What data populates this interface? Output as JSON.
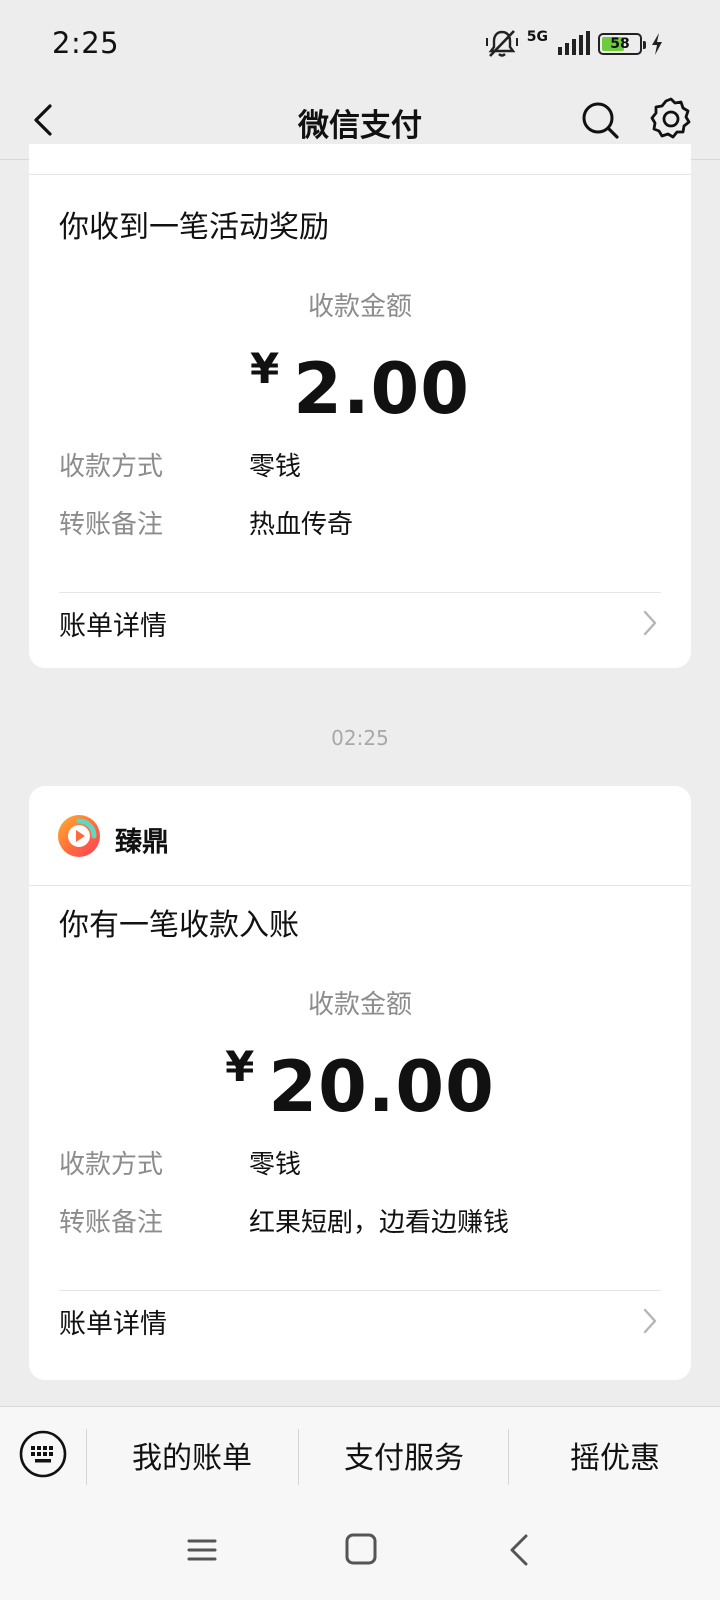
{
  "status_bar": {
    "time": "2:25",
    "network": "5G",
    "battery": "58"
  },
  "nav": {
    "title": "微信支付"
  },
  "cards": [
    {
      "title": "你收到一笔活动奖励",
      "amount_label": "收款金额",
      "currency": "¥",
      "amount": "2.00",
      "rows": [
        {
          "label": "收款方式",
          "value": "零钱"
        },
        {
          "label": "转账备注",
          "value": "热血传奇"
        }
      ],
      "detail_label": "账单详情"
    },
    {
      "brand": "臻鼎",
      "title": "你有一笔收款入账",
      "amount_label": "收款金额",
      "currency": "¥",
      "amount": "20.00",
      "rows": [
        {
          "label": "收款方式",
          "value": "零钱"
        },
        {
          "label": "转账备注",
          "value": "红果短剧，边看边赚钱"
        }
      ],
      "detail_label": "账单详情"
    }
  ],
  "timestamp": "02:25",
  "bottom_menu": {
    "items": [
      "我的账单",
      "支付服务",
      "摇优惠"
    ]
  },
  "colors": {
    "background": "#ededed",
    "card": "#ffffff",
    "battery": "#6ecb3f",
    "muted_text": "#8c8c8c"
  }
}
